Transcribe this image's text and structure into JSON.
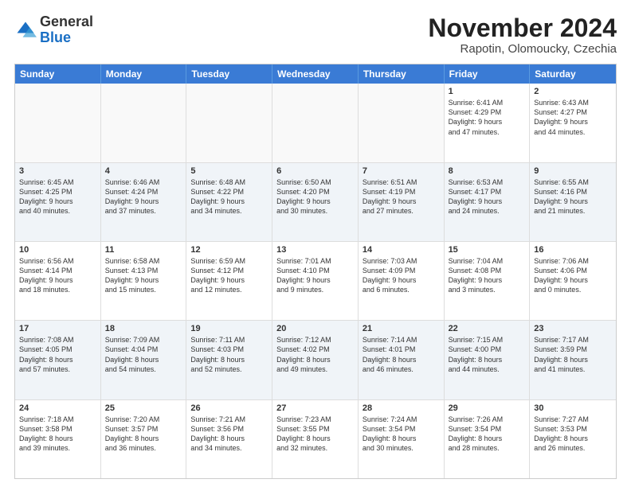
{
  "header": {
    "logo_general": "General",
    "logo_blue": "Blue",
    "month_title": "November 2024",
    "subtitle": "Rapotin, Olomoucky, Czechia"
  },
  "days_of_week": [
    "Sunday",
    "Monday",
    "Tuesday",
    "Wednesday",
    "Thursday",
    "Friday",
    "Saturday"
  ],
  "rows": [
    {
      "cells": [
        {
          "day": "",
          "info": "",
          "empty": true
        },
        {
          "day": "",
          "info": "",
          "empty": true
        },
        {
          "day": "",
          "info": "",
          "empty": true
        },
        {
          "day": "",
          "info": "",
          "empty": true
        },
        {
          "day": "",
          "info": "",
          "empty": true
        },
        {
          "day": "1",
          "info": "Sunrise: 6:41 AM\nSunset: 4:29 PM\nDaylight: 9 hours\nand 47 minutes.",
          "empty": false
        },
        {
          "day": "2",
          "info": "Sunrise: 6:43 AM\nSunset: 4:27 PM\nDaylight: 9 hours\nand 44 minutes.",
          "empty": false
        }
      ]
    },
    {
      "cells": [
        {
          "day": "3",
          "info": "Sunrise: 6:45 AM\nSunset: 4:25 PM\nDaylight: 9 hours\nand 40 minutes.",
          "empty": false
        },
        {
          "day": "4",
          "info": "Sunrise: 6:46 AM\nSunset: 4:24 PM\nDaylight: 9 hours\nand 37 minutes.",
          "empty": false
        },
        {
          "day": "5",
          "info": "Sunrise: 6:48 AM\nSunset: 4:22 PM\nDaylight: 9 hours\nand 34 minutes.",
          "empty": false
        },
        {
          "day": "6",
          "info": "Sunrise: 6:50 AM\nSunset: 4:20 PM\nDaylight: 9 hours\nand 30 minutes.",
          "empty": false
        },
        {
          "day": "7",
          "info": "Sunrise: 6:51 AM\nSunset: 4:19 PM\nDaylight: 9 hours\nand 27 minutes.",
          "empty": false
        },
        {
          "day": "8",
          "info": "Sunrise: 6:53 AM\nSunset: 4:17 PM\nDaylight: 9 hours\nand 24 minutes.",
          "empty": false
        },
        {
          "day": "9",
          "info": "Sunrise: 6:55 AM\nSunset: 4:16 PM\nDaylight: 9 hours\nand 21 minutes.",
          "empty": false
        }
      ]
    },
    {
      "cells": [
        {
          "day": "10",
          "info": "Sunrise: 6:56 AM\nSunset: 4:14 PM\nDaylight: 9 hours\nand 18 minutes.",
          "empty": false
        },
        {
          "day": "11",
          "info": "Sunrise: 6:58 AM\nSunset: 4:13 PM\nDaylight: 9 hours\nand 15 minutes.",
          "empty": false
        },
        {
          "day": "12",
          "info": "Sunrise: 6:59 AM\nSunset: 4:12 PM\nDaylight: 9 hours\nand 12 minutes.",
          "empty": false
        },
        {
          "day": "13",
          "info": "Sunrise: 7:01 AM\nSunset: 4:10 PM\nDaylight: 9 hours\nand 9 minutes.",
          "empty": false
        },
        {
          "day": "14",
          "info": "Sunrise: 7:03 AM\nSunset: 4:09 PM\nDaylight: 9 hours\nand 6 minutes.",
          "empty": false
        },
        {
          "day": "15",
          "info": "Sunrise: 7:04 AM\nSunset: 4:08 PM\nDaylight: 9 hours\nand 3 minutes.",
          "empty": false
        },
        {
          "day": "16",
          "info": "Sunrise: 7:06 AM\nSunset: 4:06 PM\nDaylight: 9 hours\nand 0 minutes.",
          "empty": false
        }
      ]
    },
    {
      "cells": [
        {
          "day": "17",
          "info": "Sunrise: 7:08 AM\nSunset: 4:05 PM\nDaylight: 8 hours\nand 57 minutes.",
          "empty": false
        },
        {
          "day": "18",
          "info": "Sunrise: 7:09 AM\nSunset: 4:04 PM\nDaylight: 8 hours\nand 54 minutes.",
          "empty": false
        },
        {
          "day": "19",
          "info": "Sunrise: 7:11 AM\nSunset: 4:03 PM\nDaylight: 8 hours\nand 52 minutes.",
          "empty": false
        },
        {
          "day": "20",
          "info": "Sunrise: 7:12 AM\nSunset: 4:02 PM\nDaylight: 8 hours\nand 49 minutes.",
          "empty": false
        },
        {
          "day": "21",
          "info": "Sunrise: 7:14 AM\nSunset: 4:01 PM\nDaylight: 8 hours\nand 46 minutes.",
          "empty": false
        },
        {
          "day": "22",
          "info": "Sunrise: 7:15 AM\nSunset: 4:00 PM\nDaylight: 8 hours\nand 44 minutes.",
          "empty": false
        },
        {
          "day": "23",
          "info": "Sunrise: 7:17 AM\nSunset: 3:59 PM\nDaylight: 8 hours\nand 41 minutes.",
          "empty": false
        }
      ]
    },
    {
      "cells": [
        {
          "day": "24",
          "info": "Sunrise: 7:18 AM\nSunset: 3:58 PM\nDaylight: 8 hours\nand 39 minutes.",
          "empty": false
        },
        {
          "day": "25",
          "info": "Sunrise: 7:20 AM\nSunset: 3:57 PM\nDaylight: 8 hours\nand 36 minutes.",
          "empty": false
        },
        {
          "day": "26",
          "info": "Sunrise: 7:21 AM\nSunset: 3:56 PM\nDaylight: 8 hours\nand 34 minutes.",
          "empty": false
        },
        {
          "day": "27",
          "info": "Sunrise: 7:23 AM\nSunset: 3:55 PM\nDaylight: 8 hours\nand 32 minutes.",
          "empty": false
        },
        {
          "day": "28",
          "info": "Sunrise: 7:24 AM\nSunset: 3:54 PM\nDaylight: 8 hours\nand 30 minutes.",
          "empty": false
        },
        {
          "day": "29",
          "info": "Sunrise: 7:26 AM\nSunset: 3:54 PM\nDaylight: 8 hours\nand 28 minutes.",
          "empty": false
        },
        {
          "day": "30",
          "info": "Sunrise: 7:27 AM\nSunset: 3:53 PM\nDaylight: 8 hours\nand 26 minutes.",
          "empty": false
        }
      ]
    }
  ]
}
